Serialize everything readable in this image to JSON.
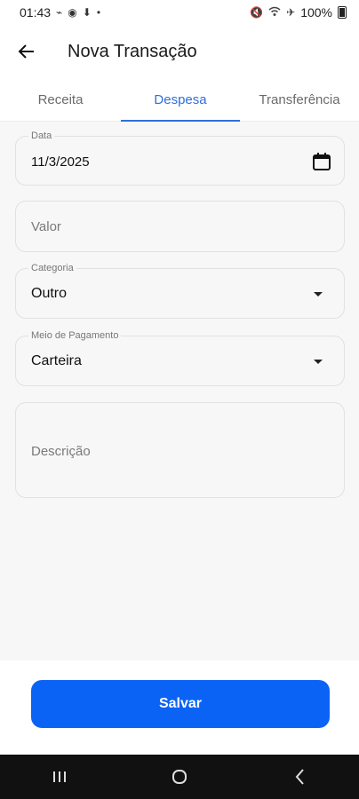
{
  "status_bar": {
    "time": "01:43",
    "battery": "100%",
    "left_icons": [
      "voicemail-icon",
      "whatsapp-icon",
      "download-icon",
      "dot-icon"
    ],
    "right_icons": [
      "mute-icon",
      "wifi-icon",
      "airplane-icon",
      "battery-icon"
    ]
  },
  "app_bar": {
    "title": "Nova Transação",
    "back_icon": "arrow-left-icon"
  },
  "tabs": {
    "items": [
      {
        "label": "Receita"
      },
      {
        "label": "Despesa",
        "active": true
      },
      {
        "label": "Transferência"
      }
    ],
    "accent_color": "#2f6fdd"
  },
  "form": {
    "date": {
      "label": "Data",
      "value": "11/3/2025",
      "icon": "calendar-icon"
    },
    "amount": {
      "placeholder": "Valor"
    },
    "category": {
      "label": "Categoria",
      "value": "Outro"
    },
    "payment_method": {
      "label": "Meio de Pagamento",
      "value": "Carteira"
    },
    "description": {
      "placeholder": "Descrição"
    }
  },
  "actions": {
    "save_label": "Salvar",
    "button_color": "#0b63f6"
  },
  "nav_bar": {
    "buttons": [
      "recent-apps-icon",
      "home-icon",
      "back-icon"
    ]
  }
}
